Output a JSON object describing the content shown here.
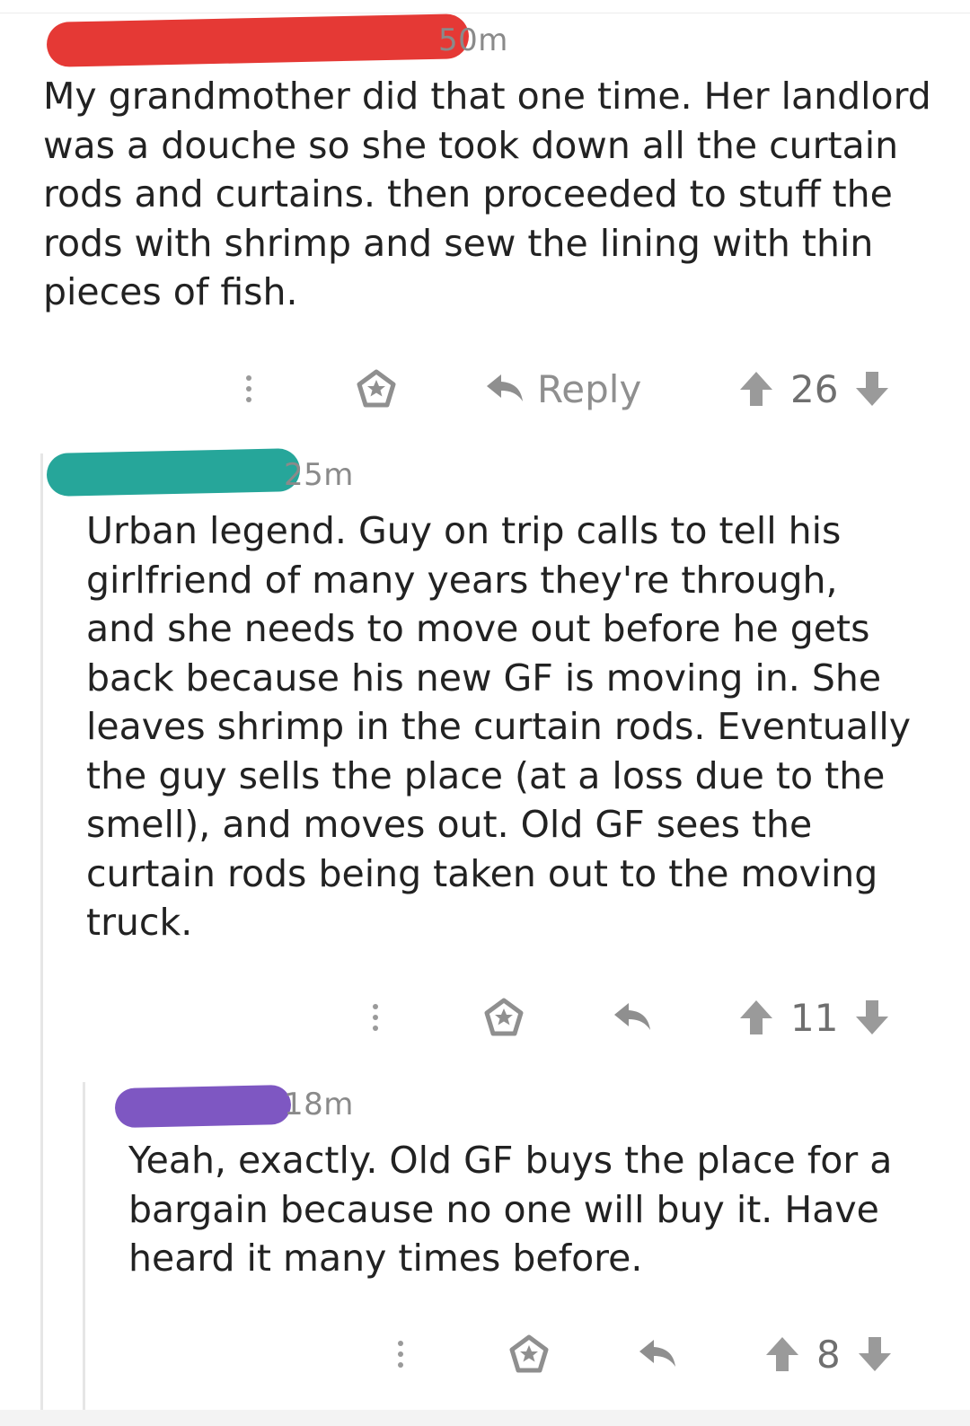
{
  "comments": [
    {
      "redaction_color": "#e53935",
      "time": "50m",
      "text": "My grandmother did that one time. Her landlord was a douche so she took down all the curtain rods and curtains.  then proceeded to stuff the rods with shrimp and sew the lining with thin pieces of fish.",
      "reply_label": "Reply",
      "score": "26"
    },
    {
      "redaction_color": "#26a69a",
      "time": "25m",
      "text": "Urban legend. Guy on trip calls to tell his girlfriend of many years they're through, and she needs to move out before he gets back because his new GF is moving in. She leaves shrimp in the curtain rods. Eventually the guy sells the place (at a loss due to the smell), and moves out. Old GF sees the curtain rods being taken out to the moving truck.",
      "score": "11"
    },
    {
      "redaction_color": "#7e57c2",
      "time": "18m",
      "text": "Yeah, exactly. Old GF buys the place for a bargain because no one will buy it. Have heard it many times before.",
      "score": "8"
    }
  ],
  "icons": {
    "more": "more-options-icon",
    "award": "award-icon",
    "reply": "reply-arrow-icon",
    "upvote": "upvote-arrow-icon",
    "downvote": "downvote-arrow-icon"
  },
  "colors": {
    "meta_text": "#8a8a8a",
    "icon": "#8f8f8f",
    "thread_line": "#e6e6e6"
  }
}
